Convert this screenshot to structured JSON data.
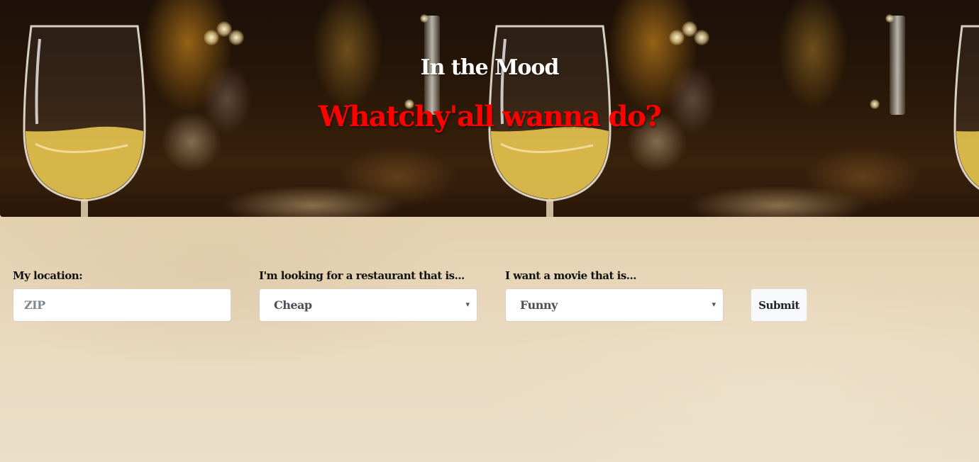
{
  "header": {
    "title": "In the Mood",
    "subtitle": "Whatchy'all wanna do?"
  },
  "form": {
    "location": {
      "label": "My location:",
      "placeholder": "ZIP",
      "value": ""
    },
    "restaurant": {
      "label": "I'm looking for a restaurant that is...",
      "selected": "Cheap"
    },
    "movie": {
      "label": "I want a movie that is...",
      "selected": "Funny"
    },
    "submit_label": "Submit"
  },
  "icons": {
    "select_caret": "▾"
  },
  "colors": {
    "title": "#ffffff",
    "subtitle": "#ff0000",
    "paper_background": "#e6d4b6",
    "input_background": "#ffffff",
    "submit_background": "#f8f9fa"
  }
}
